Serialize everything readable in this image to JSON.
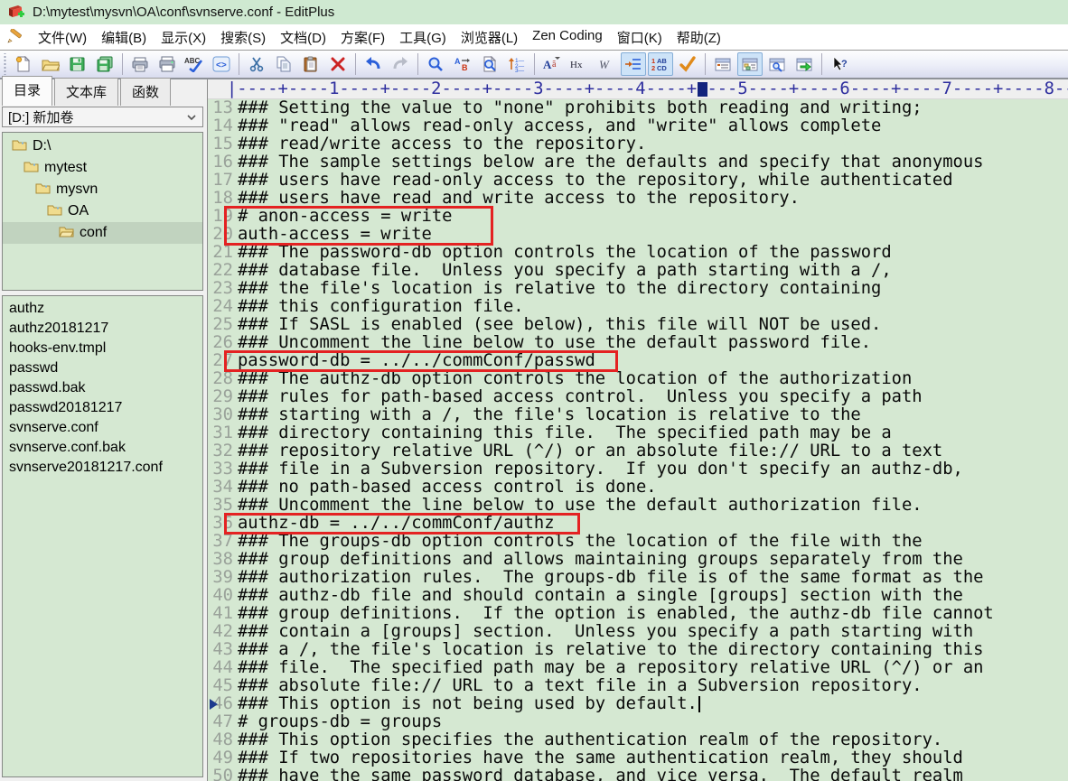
{
  "window": {
    "title": "D:\\mytest\\mysvn\\OA\\conf\\svnserve.conf - EditPlus",
    "app_icon": "editplus-icon"
  },
  "menu": {
    "items": [
      "文件(W)",
      "编辑(B)",
      "显示(X)",
      "搜索(S)",
      "文档(D)",
      "方案(F)",
      "工具(G)",
      "浏览器(L)",
      "Zen Coding",
      "窗口(K)",
      "帮助(Z)"
    ]
  },
  "toolbar": {
    "buttons": [
      {
        "name": "new-file",
        "icon": "new-file"
      },
      {
        "name": "open-file",
        "icon": "open-file"
      },
      {
        "name": "save",
        "icon": "save"
      },
      {
        "name": "save-all",
        "icon": "save-all"
      },
      {
        "separator": true
      },
      {
        "name": "print-preview",
        "icon": "print-preview"
      },
      {
        "name": "print",
        "icon": "print"
      },
      {
        "name": "spell-check",
        "icon": "spell-check"
      },
      {
        "name": "html-toolbar",
        "icon": "html-toolbar"
      },
      {
        "separator": true
      },
      {
        "name": "cut",
        "icon": "cut"
      },
      {
        "name": "copy",
        "icon": "copy"
      },
      {
        "name": "paste",
        "icon": "paste"
      },
      {
        "name": "delete",
        "icon": "delete"
      },
      {
        "separator": true
      },
      {
        "name": "undo",
        "icon": "undo"
      },
      {
        "name": "redo",
        "icon": "redo"
      },
      {
        "separator": true
      },
      {
        "name": "find",
        "icon": "find"
      },
      {
        "name": "replace",
        "icon": "replace"
      },
      {
        "name": "find-in-files",
        "icon": "find-in-files"
      },
      {
        "name": "sort-lines",
        "icon": "sort-lines"
      },
      {
        "separator": true
      },
      {
        "name": "set-font",
        "icon": "set-font"
      },
      {
        "name": "hex-viewer",
        "icon": "hex-viewer"
      },
      {
        "name": "word-wrap",
        "icon": "word-wrap"
      },
      {
        "name": "indent-guide",
        "icon": "indent-guide",
        "pressed": true
      },
      {
        "name": "line-numbers",
        "icon": "line-numbers",
        "pressed": true
      },
      {
        "name": "syntax-check",
        "icon": "syntax-check"
      },
      {
        "separator": true
      },
      {
        "name": "document-list",
        "icon": "document-list"
      },
      {
        "name": "directory-window",
        "icon": "directory-window",
        "pressed": true
      },
      {
        "name": "browser-preview",
        "icon": "browser-preview"
      },
      {
        "name": "view-in-browser",
        "icon": "view-in-browser"
      },
      {
        "separator": true
      },
      {
        "name": "context-help",
        "icon": "context-help"
      }
    ]
  },
  "sidebar": {
    "tabs": [
      {
        "label": "目录",
        "active": true
      },
      {
        "label": "文本库",
        "active": false
      },
      {
        "label": "函数",
        "active": false
      }
    ],
    "drive_selector": {
      "value": "[D:] 新加卷"
    },
    "tree": [
      {
        "label": "D:\\",
        "depth": 0,
        "selected": false
      },
      {
        "label": "mytest",
        "depth": 1,
        "selected": false
      },
      {
        "label": "mysvn",
        "depth": 2,
        "selected": false
      },
      {
        "label": "OA",
        "depth": 3,
        "selected": false
      },
      {
        "label": "conf",
        "depth": 4,
        "selected": true
      }
    ],
    "files": [
      "authz",
      "authz20181217",
      "hooks-env.tmpl",
      "passwd",
      "passwd.bak",
      "passwd20181217",
      "svnserve.conf",
      "svnserve.conf.bak",
      "svnserve20181217.conf"
    ]
  },
  "editor": {
    "first_line": 13,
    "lines": [
      "### Setting the value to \"none\" prohibits both reading and writing;",
      "### \"read\" allows read-only access, and \"write\" allows complete",
      "### read/write access to the repository.",
      "### The sample settings below are the defaults and specify that anonymous",
      "### users have read-only access to the repository, while authenticated",
      "### users have read and write access to the repository.",
      "# anon-access = write",
      "auth-access = write",
      "### The password-db option controls the location of the password",
      "### database file.  Unless you specify a path starting with a /,",
      "### the file's location is relative to the directory containing",
      "### this configuration file.",
      "### If SASL is enabled (see below), this file will NOT be used.",
      "### Uncomment the line below to use the default password file.",
      "password-db = ../../commConf/passwd",
      "### The authz-db option controls the location of the authorization",
      "### rules for path-based access control.  Unless you specify a path",
      "### starting with a /, the file's location is relative to the",
      "### directory containing this file.  The specified path may be a",
      "### repository relative URL (^/) or an absolute file:// URL to a text",
      "### file in a Subversion repository.  If you don't specify an authz-db,",
      "### no path-based access control is done.",
      "### Uncomment the line below to use the default authorization file.",
      "authz-db = ../../commConf/authz",
      "### The groups-db option controls the location of the file with the",
      "### group definitions and allows maintaining groups separately from the",
      "### authorization rules.  The groups-db file is of the same format as the",
      "### authz-db file and should contain a single [groups] section with the",
      "### group definitions.  If the option is enabled, the authz-db file cannot",
      "### contain a [groups] section.  Unless you specify a path starting with",
      "### a /, the file's location is relative to the directory containing this",
      "### file.  The specified path may be a repository relative URL (^/) or an",
      "### absolute file:// URL to a text file in a Subversion repository.",
      "### This option is not being used by default.",
      "# groups-db = groups",
      "### This option specifies the authentication realm of the repository.",
      "### If two repositories have the same authentication realm, they should",
      "### have the same password database, and vice versa.  The default realm"
    ],
    "cursor": {
      "line": 46,
      "col": 46
    },
    "highlights": [
      {
        "from_line": 19,
        "to_line": 20,
        "to_col": 25
      },
      {
        "from_line": 27,
        "to_line": 27,
        "to_col": 37.2
      },
      {
        "from_line": 36,
        "to_line": 36,
        "to_col": 33.5
      }
    ],
    "ruler": {
      "text": "|----+----1----+----2----+----3----+----4----+----5----+----6----+----7----+----8--",
      "marker_col": 46
    }
  },
  "colors": {
    "titlebar_bg": "#cfe9d1",
    "editor_bg": "#d5e8d2",
    "selected_row_bg": "#c1d3bf",
    "highlight_border": "#e42222",
    "ruler_ink": "#2d2d9e",
    "line_number": "#9aa29a"
  }
}
